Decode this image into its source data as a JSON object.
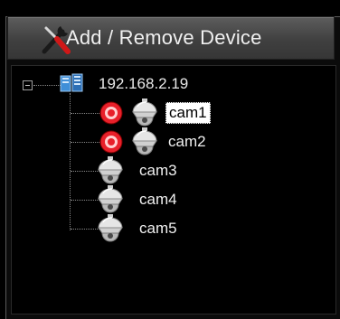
{
  "toolbar": {
    "add_remove_label": "Add / Remove Device",
    "icon": "tools-icon"
  },
  "tree": {
    "server": {
      "label": "192.168.2.19",
      "icon": "server-icon",
      "expanded": true
    },
    "cameras": [
      {
        "label": "cam1",
        "recording": true,
        "selected": true
      },
      {
        "label": "cam2",
        "recording": true,
        "selected": false
      },
      {
        "label": "cam3",
        "recording": false,
        "selected": false
      },
      {
        "label": "cam4",
        "recording": false,
        "selected": false
      },
      {
        "label": "cam5",
        "recording": false,
        "selected": false
      }
    ]
  },
  "colors": {
    "background": "#000000",
    "toolbar": "#4a4a4a",
    "text": "#f0f0f0",
    "recording": "#e8202a"
  }
}
